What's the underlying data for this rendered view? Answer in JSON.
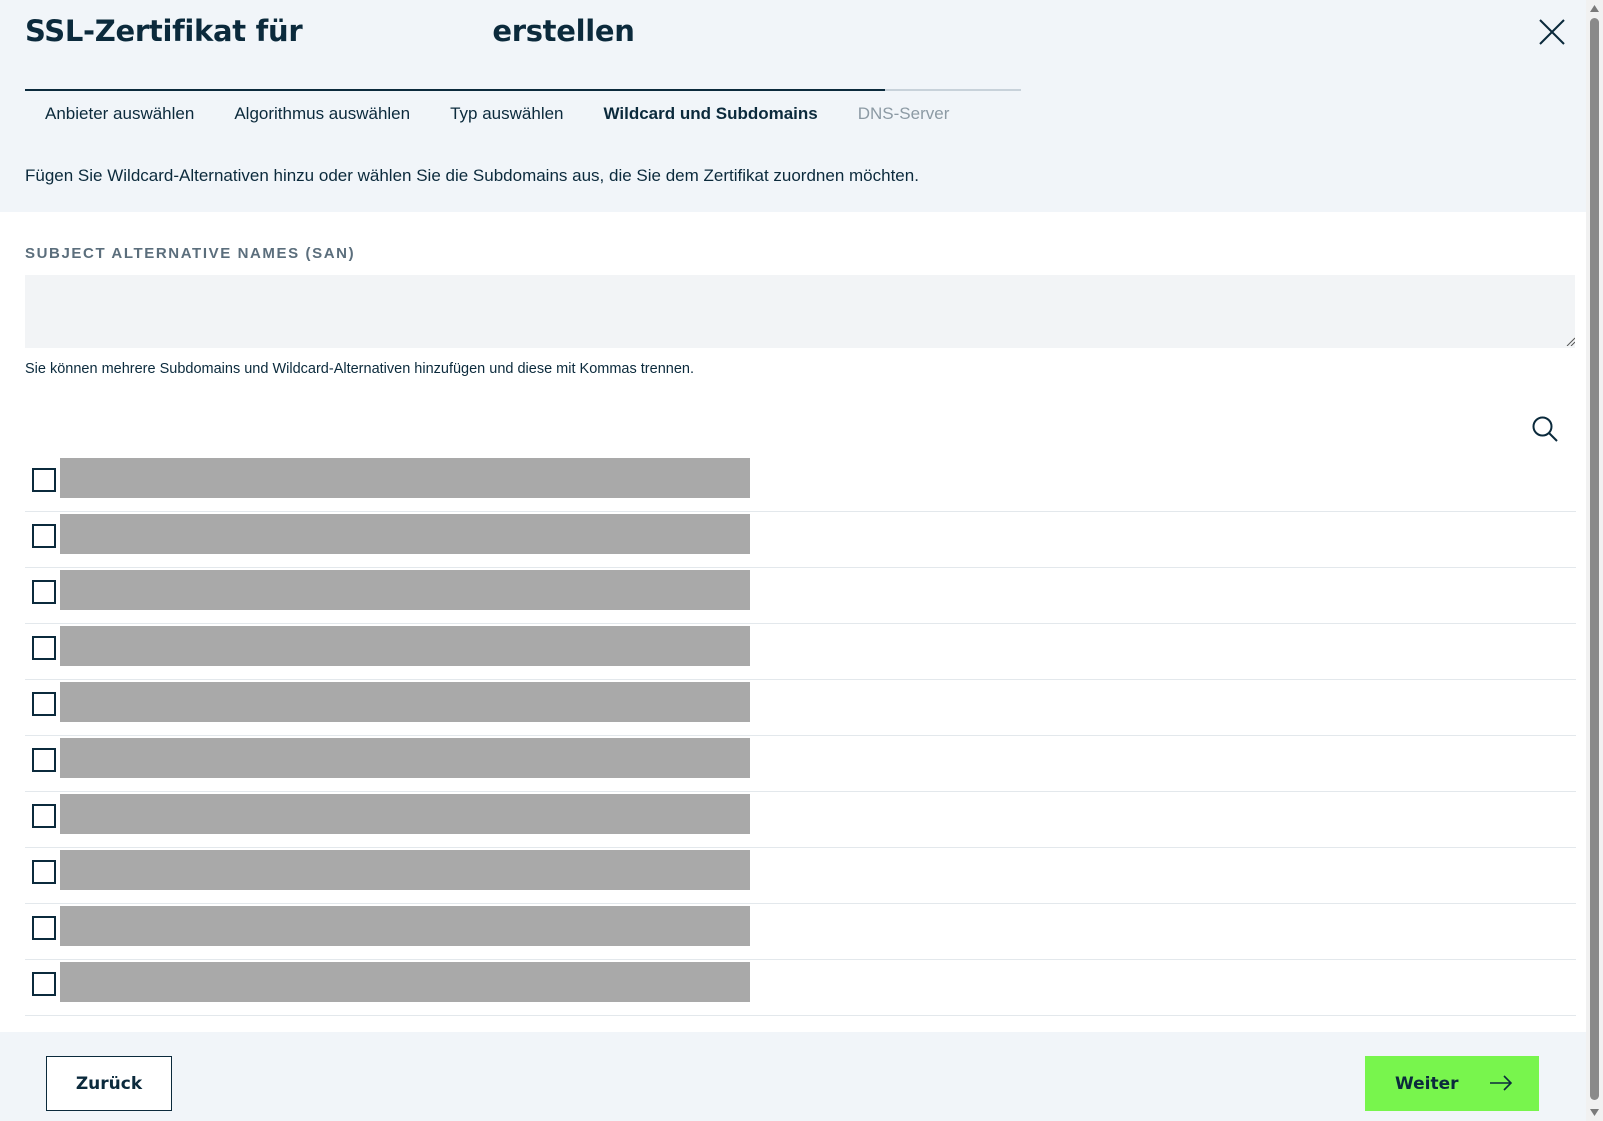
{
  "modal": {
    "title_prefix": "SSL-Zertifikat für",
    "title_suffix": "erstellen",
    "close_icon": "close-icon"
  },
  "stepper": {
    "steps": [
      {
        "label": "Anbieter auswählen",
        "state": "done"
      },
      {
        "label": "Algorithmus auswählen",
        "state": "done"
      },
      {
        "label": "Typ auswählen",
        "state": "done"
      },
      {
        "label": "Wildcard und Subdomains",
        "state": "active"
      },
      {
        "label": "DNS-Server",
        "state": "disabled"
      }
    ]
  },
  "intro_text": "Fügen Sie Wildcard-Alternativen hinzu oder wählen Sie die Subdomains aus, die Sie dem Zertifikat zuordnen möchten.",
  "san": {
    "label": "SUBJECT ALTERNATIVE NAMES (SAN)",
    "value": "",
    "hint": "Sie können mehrere Subdomains und Wildcard-Alternativen hinzufügen und diese mit Kommas trennen."
  },
  "search_icon": "search-icon",
  "subdomain_rows": [
    {
      "checked": false
    },
    {
      "checked": false
    },
    {
      "checked": false
    },
    {
      "checked": false
    },
    {
      "checked": false
    },
    {
      "checked": false
    },
    {
      "checked": false
    },
    {
      "checked": false
    },
    {
      "checked": false
    },
    {
      "checked": false
    }
  ],
  "footer": {
    "back_label": "Zurück",
    "next_label": "Weiter",
    "next_icon": "arrow-right-icon"
  },
  "colors": {
    "primary": "#0b2a3c",
    "accent": "#78f54d",
    "band": "#f1f5f9",
    "redaction": "#a9a9a9"
  }
}
